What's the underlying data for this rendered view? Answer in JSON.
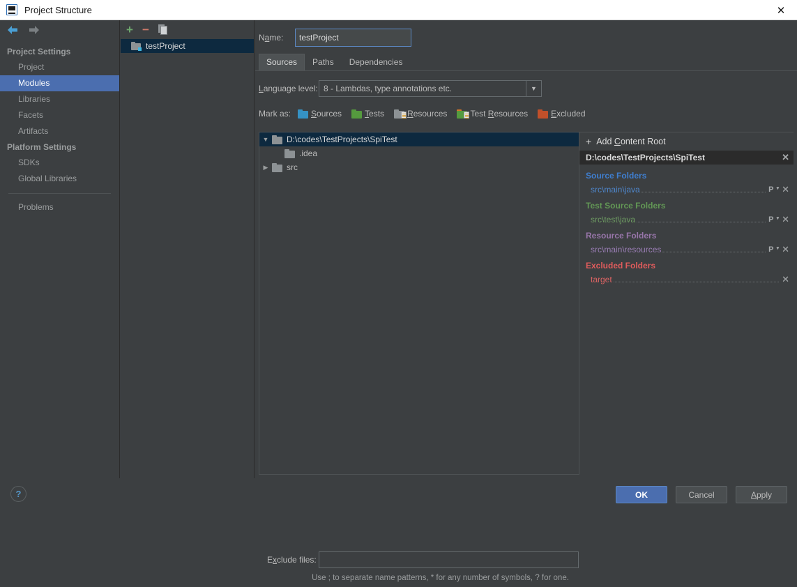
{
  "window": {
    "title": "Project Structure",
    "icon": "intellij-idea-icon",
    "close_label": "✕"
  },
  "nav": {
    "back_icon": "arrow-left-icon",
    "forward_icon": "arrow-right-icon",
    "groups": [
      {
        "label": "Project Settings",
        "items": [
          {
            "label": "Project",
            "selected": false
          },
          {
            "label": "Modules",
            "selected": true
          },
          {
            "label": "Libraries",
            "selected": false
          },
          {
            "label": "Facets",
            "selected": false
          },
          {
            "label": "Artifacts",
            "selected": false
          }
        ]
      },
      {
        "label": "Platform Settings",
        "items": [
          {
            "label": "SDKs",
            "selected": false
          },
          {
            "label": "Global Libraries",
            "selected": false
          }
        ]
      }
    ],
    "problems": {
      "label": "Problems"
    }
  },
  "modules": {
    "toolbar": {
      "add": "+",
      "remove": "−",
      "copy_icon": "copy-icon"
    },
    "items": [
      {
        "label": "testProject",
        "selected": true
      }
    ]
  },
  "main": {
    "name": {
      "label_pre": "N",
      "label_mnemonic": "a",
      "label_post": "me:",
      "value": "testProject",
      "placeholder": ""
    },
    "tabs": [
      {
        "label": "Sources",
        "active": true
      },
      {
        "label": "Paths",
        "active": false
      },
      {
        "label": "Dependencies",
        "active": false
      }
    ],
    "language_level": {
      "label_pre": "",
      "label_mnemonic": "L",
      "label_post": "anguage level:",
      "value": "8 - Lambdas, type annotations etc.",
      "arrow": "▼",
      "options": [
        "8 - Lambdas, type annotations etc."
      ]
    },
    "mark_as": {
      "label": "Mark as:",
      "items": [
        {
          "pre": "",
          "mnemonic": "S",
          "post": "ources",
          "icon": "folder-blue-icon"
        },
        {
          "pre": "",
          "mnemonic": "T",
          "post": "ests",
          "icon": "folder-green-icon"
        },
        {
          "pre": "",
          "mnemonic": "R",
          "post": "esources",
          "icon": "folder-resources-icon"
        },
        {
          "pre": "Test ",
          "mnemonic": "R",
          "post": "esources",
          "icon": "folder-test-resources-icon"
        },
        {
          "pre": "",
          "mnemonic": "E",
          "post": "xcluded",
          "icon": "folder-orange-icon"
        }
      ]
    },
    "tree": [
      {
        "label": "D:\\codes\\TestProjects\\SpiTest",
        "twisty": "▼",
        "selected": true,
        "indent": 0
      },
      {
        "label": ".idea",
        "twisty": "",
        "selected": false,
        "indent": 1
      },
      {
        "label": "src",
        "twisty": "▶",
        "selected": false,
        "indent": 0
      }
    ],
    "exclude_files": {
      "label_pre": "E",
      "label_mnemonic": "x",
      "label_post": "clude files:",
      "value": "",
      "placeholder": "",
      "hint": "Use ; to separate name patterns, * for any number of symbols, ? for one."
    }
  },
  "roots": {
    "add_content_root": {
      "plus": "+",
      "pre": "Add ",
      "mnemonic": "C",
      "post": "ontent Root"
    },
    "content_root": {
      "path": "D:\\codes\\TestProjects\\SpiTest",
      "close": "✕"
    },
    "groups": [
      {
        "title": "Source Folders",
        "kind": "src",
        "color": "#3f7fd0",
        "entries": [
          {
            "path": "src\\main\\java",
            "prefix_icon": "package-prefix-icon",
            "remove": "✕"
          }
        ]
      },
      {
        "title": "Test Source Folders",
        "kind": "test",
        "color": "#629755",
        "entries": [
          {
            "path": "src\\test\\java",
            "prefix_icon": "package-prefix-icon",
            "remove": "✕"
          }
        ]
      },
      {
        "title": "Resource Folders",
        "kind": "res",
        "color": "#9876aa",
        "entries": [
          {
            "path": "src\\main\\resources",
            "prefix_icon": "package-prefix-icon",
            "remove": "✕"
          }
        ]
      },
      {
        "title": "Excluded Folders",
        "kind": "exc",
        "color": "#e05c5c",
        "entries": [
          {
            "path": "target",
            "prefix_icon": "",
            "remove": "✕"
          }
        ]
      }
    ]
  },
  "footer": {
    "help": "?",
    "buttons": [
      {
        "label": "OK",
        "primary": true,
        "mnemonic": ""
      },
      {
        "label": "Cancel",
        "primary": false,
        "mnemonic": ""
      },
      {
        "label": "Apply",
        "primary": false,
        "mnemonic": "A"
      }
    ]
  },
  "colors": {
    "accent": "#4b6eaf",
    "selection_tree": "#0d293f",
    "background": "#3c3f41",
    "source": "#3f7fd0",
    "test": "#629755",
    "resource": "#9876aa",
    "excluded": "#e05c5c"
  }
}
